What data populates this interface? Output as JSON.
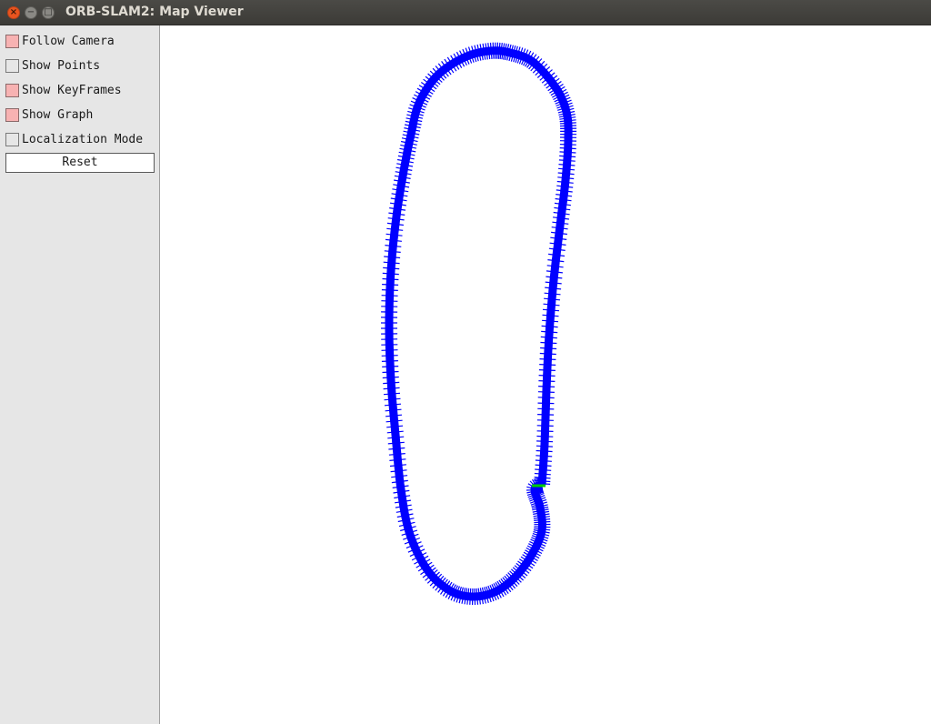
{
  "window": {
    "title": "ORB-SLAM2: Map Viewer",
    "controls": {
      "close_icon": "close-icon",
      "minimize_icon": "minimize-icon",
      "maximize_icon": "maximize-icon"
    }
  },
  "panel": {
    "options": [
      {
        "label": "Follow Camera",
        "checked": true
      },
      {
        "label": "Show Points",
        "checked": false
      },
      {
        "label": "Show KeyFrames",
        "checked": true
      },
      {
        "label": "Show Graph",
        "checked": true
      },
      {
        "label": "Localization Mode",
        "checked": false
      }
    ],
    "reset_label": "Reset",
    "checked_color": "#f7b2b2"
  },
  "map": {
    "keyframe_color": "#0000ff",
    "current_camera_color": "#00cc00"
  }
}
